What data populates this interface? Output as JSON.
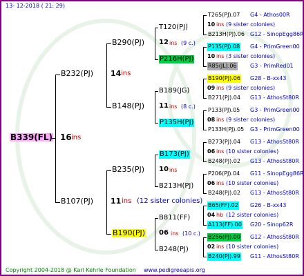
{
  "header": {
    "date": "13- 12-2018 ( 21: 29)"
  },
  "footer": {
    "copyright": "Copyright 2004-2018 @ Karl Kehrle Foundation",
    "site": "www.pedigreeapis.org"
  },
  "colors": {
    "border": "#800080",
    "pink": "#ffaaff",
    "yellow": "#ffff00",
    "cyan": "#00ffff",
    "green": "#00cc44",
    "gray": "#aaaaaa",
    "ins_red": "#cc0000",
    "blue_text": "#0000cc",
    "green_text": "#008000"
  },
  "root": {
    "name": "B339(FL)",
    "num": "16",
    "ins": "ins"
  },
  "gen1": {
    "top": {
      "name": "B232(PJ)",
      "num": "14",
      "ins": "ins"
    },
    "bottom": {
      "name": "B107(PJ)",
      "num": "11",
      "ins": "ins",
      "note": "(12 sister colonies)"
    }
  },
  "gen2": {
    "b290": {
      "name": "B290(PJ)",
      "num": "12",
      "ins": "ins",
      "note": "(9 c.)"
    },
    "b148": {
      "name": "B148(PJ)",
      "num": "11",
      "ins": "ins",
      "note": "(8 c.)"
    },
    "b235": {
      "name": "B235(PJ)",
      "num": "10",
      "ins": "ins"
    },
    "b190": {
      "name": "B190(PJ)",
      "num": "06",
      "ins": "ins",
      "note": "(10 c.)"
    }
  },
  "gen3": {
    "t120": {
      "name": "T120(PJ)"
    },
    "p216": {
      "name": "P216H(PJ)"
    },
    "b189": {
      "name": "B189(JG)"
    },
    "p135h": {
      "name": "P135H(PJ)"
    },
    "b173": {
      "name": "B173(PJ)"
    },
    "b213h": {
      "name": "B213H(PJ)"
    },
    "b811": {
      "name": "B811(FF)"
    },
    "b248": {
      "name": "B248(PJ)"
    }
  },
  "gen4": [
    {
      "top": "T265(PJ).07",
      "top_right": "G4 - Athos00R",
      "num": "10",
      "ins": "ins",
      "note": "(9 sister colonies)",
      "bottom": "B213H(PJ).06",
      "bottom_right": "G12 - SinopEgg86R"
    },
    {
      "top": "P135(PJ).08",
      "top_right": "G4 - PrimGreen00",
      "num": "10",
      "ins": "ins",
      "note": "(3 sister colonies)",
      "bottom": "R85(JL).06",
      "bottom_right": "G3 - PrimRed01"
    },
    {
      "top": "B190(PJ).06",
      "top_right": "G28 - B-xx43",
      "num": "09",
      "ins": "ins",
      "note": "(9 sister colonies)",
      "bottom": "B271(PJ).04",
      "bottom_right": "G13 - AthosSt80R"
    },
    {
      "top": "P133(PJ).05",
      "top_right": "G3 - PrimGreen00",
      "num": "08",
      "ins": "ins",
      "note": "(9 sister colonies)",
      "bottom": "P133H(PJ).05",
      "bottom_right": "G3 - PrimGreen00"
    },
    {
      "top": "B273(PJ).04",
      "top_right": "G13 - AthosSt80R",
      "num": "06",
      "ins": "ins",
      "note": "(10 sister colonies)",
      "bottom": "B248(PJ).02",
      "bottom_right": "G13 - AthosSt80R"
    },
    {
      "top": "P206(PJ).04",
      "top_right": "G11 - SinopEgg86R",
      "num": "06",
      "ins": "ins",
      "note": "(10 sister colonies)",
      "bottom": "B248(PJ).02",
      "bottom_right": "G13 - AthosSt80R"
    },
    {
      "top": "B65(FF).02",
      "top_right": "G26 - B-xx43",
      "num": "04",
      "ins": "hb",
      "note": "(12 sister colonies)",
      "bottom": "A113(FF).00",
      "bottom_right": "G20 - Sinop62R"
    },
    {
      "top": "B256(PJ).00",
      "top_right": "G12 - AthosSt80R",
      "num": "02",
      "ins": "ins",
      "note": "(10 sister colonies)",
      "bottom": "B240(PJ).99",
      "bottom_right": "G11 - AthosSt80R"
    }
  ]
}
